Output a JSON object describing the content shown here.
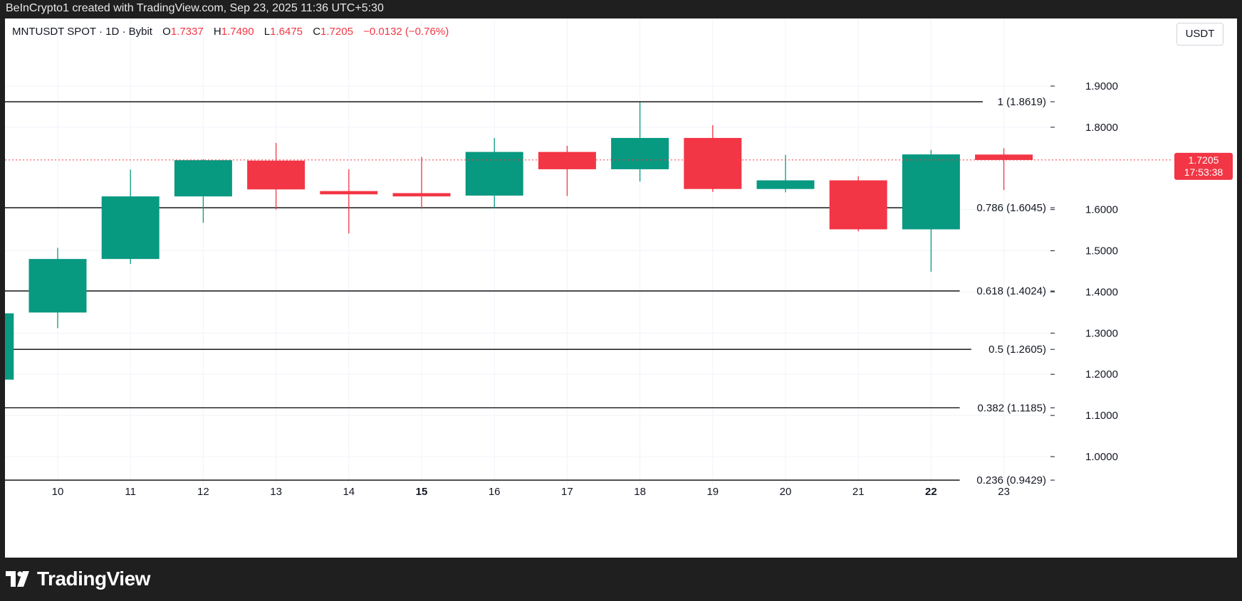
{
  "header": {
    "attribution": "BeInCrypto1 created with TradingView.com, Sep 23, 2025 11:36 UTC+5:30"
  },
  "legend": {
    "symbol": "MNTUSDT SPOT · 1D · Bybit",
    "open_label": "O",
    "open_value": "1.7337",
    "high_label": "H",
    "high_value": "1.7490",
    "low_label": "L",
    "low_value": "1.6475",
    "close_label": "C",
    "close_value": "1.7205",
    "change": "−0.0132 (−0.76%)"
  },
  "currency": "USDT",
  "footer": {
    "brand": "TradingView"
  },
  "colors": {
    "up": "#089981",
    "down": "#f23645",
    "grid": "#f0f3fa",
    "fib_line": "#000000"
  },
  "chart_data": {
    "type": "candlestick",
    "y_axis": {
      "ticks": [
        "1.9000",
        "1.8000",
        "1.6000",
        "1.5000",
        "1.4000",
        "1.3000",
        "1.2000",
        "1.1000",
        "1.0000"
      ],
      "range": [
        0.88,
        1.98
      ]
    },
    "x_axis": {
      "ticks": [
        {
          "label": "10",
          "bold": false
        },
        {
          "label": "11",
          "bold": false
        },
        {
          "label": "12",
          "bold": false
        },
        {
          "label": "13",
          "bold": false
        },
        {
          "label": "14",
          "bold": false
        },
        {
          "label": "15",
          "bold": true
        },
        {
          "label": "16",
          "bold": false
        },
        {
          "label": "17",
          "bold": false
        },
        {
          "label": "18",
          "bold": false
        },
        {
          "label": "19",
          "bold": false
        },
        {
          "label": "20",
          "bold": false
        },
        {
          "label": "21",
          "bold": false
        },
        {
          "label": "22",
          "bold": true
        },
        {
          "label": "23",
          "bold": false
        }
      ]
    },
    "candles": [
      {
        "x": "9",
        "open": 1.187,
        "high": 1.348,
        "low": 1.187,
        "close": 1.348
      },
      {
        "x": "10",
        "open": 1.35,
        "high": 1.507,
        "low": 1.312,
        "close": 1.48
      },
      {
        "x": "11",
        "open": 1.48,
        "high": 1.697,
        "low": 1.468,
        "close": 1.632
      },
      {
        "x": "12",
        "open": 1.632,
        "high": 1.722,
        "low": 1.568,
        "close": 1.72
      },
      {
        "x": "13",
        "open": 1.719,
        "high": 1.762,
        "low": 1.6,
        "close": 1.649
      },
      {
        "x": "14",
        "open": 1.645,
        "high": 1.698,
        "low": 1.542,
        "close": 1.637
      },
      {
        "x": "15",
        "open": 1.64,
        "high": 1.728,
        "low": 1.602,
        "close": 1.632
      },
      {
        "x": "16",
        "open": 1.634,
        "high": 1.774,
        "low": 1.603,
        "close": 1.74
      },
      {
        "x": "17",
        "open": 1.74,
        "high": 1.755,
        "low": 1.633,
        "close": 1.698
      },
      {
        "x": "18",
        "open": 1.698,
        "high": 1.861,
        "low": 1.668,
        "close": 1.774
      },
      {
        "x": "19",
        "open": 1.774,
        "high": 1.805,
        "low": 1.643,
        "close": 1.65
      },
      {
        "x": "20",
        "open": 1.65,
        "high": 1.733,
        "low": 1.642,
        "close": 1.671
      },
      {
        "x": "21",
        "open": 1.671,
        "high": 1.681,
        "low": 1.547,
        "close": 1.552
      },
      {
        "x": "22",
        "open": 1.552,
        "high": 1.745,
        "low": 1.449,
        "close": 1.734
      },
      {
        "x": "23",
        "open": 1.7337,
        "high": 1.749,
        "low": 1.6475,
        "close": 1.7205
      }
    ],
    "fib_levels": [
      {
        "label": "1 (1.8619)",
        "value": 1.8619
      },
      {
        "label": "0.786 (1.6045)",
        "value": 1.6045
      },
      {
        "label": "0.618 (1.4024)",
        "value": 1.4024
      },
      {
        "label": "0.5 (1.2605)",
        "value": 1.2605
      },
      {
        "label": "0.382 (1.1185)",
        "value": 1.1185
      },
      {
        "label": "0.236 (0.9429)",
        "value": 0.9429
      }
    ],
    "last_price": {
      "value": 1.7205,
      "price_text": "1.7205",
      "countdown": "17:53:38"
    }
  }
}
